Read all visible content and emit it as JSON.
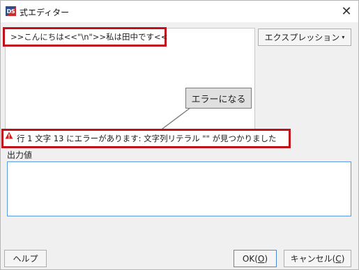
{
  "window": {
    "app_icon_text": "DS",
    "title": "式エディター",
    "close_glyph": "✕"
  },
  "expression": {
    "text": ">>こんにちは<<\"\\n\">>私は田中です<<"
  },
  "expression_dropdown": {
    "label": "エクスプレッション",
    "caret": "▾"
  },
  "callout": {
    "text": "エラーになる"
  },
  "error": {
    "icon": "warning-icon",
    "message": "行 1 文字 13 にエラーがあります: 文字列リテラル \"\" が見つかりました"
  },
  "output": {
    "label": "出力値",
    "value": ""
  },
  "buttons": {
    "help": "ヘルプ",
    "ok_prefix": "OK(",
    "ok_mnemonic": "O",
    "ok_suffix": ")",
    "cancel_prefix": "キャンセル(",
    "cancel_mnemonic": "C",
    "cancel_suffix": ")"
  },
  "colors": {
    "highlight_red": "#c0101a",
    "output_border": "#5a9be0",
    "warning": "#d4201a"
  }
}
